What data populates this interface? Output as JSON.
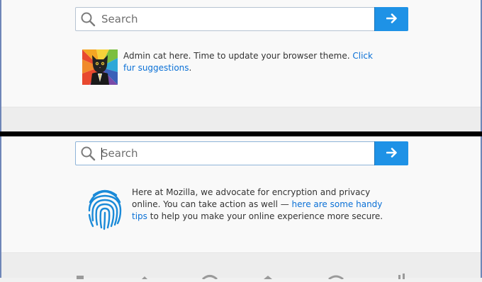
{
  "top_panel": {
    "search": {
      "placeholder": "Search"
    },
    "snippet": {
      "text": "Admin cat here. Time to update your browser theme. ",
      "link": "Click fur suggestions",
      "tail": "."
    }
  },
  "bottom_panel": {
    "search": {
      "placeholder": "Search"
    },
    "snippet": {
      "text_before": "Here at Mozilla, we advocate for encryption and privacy online. You can take action as well — ",
      "link": "here are some handy tips",
      "text_after": " to help you make your online experience more secure."
    }
  },
  "icons": {
    "search": "search-icon",
    "go": "arrow-right-icon",
    "cat": "admin-cat-image",
    "fingerprint": "fingerprint-icon"
  },
  "colors": {
    "accent": "#1e92e6",
    "link": "#0a70d6",
    "fingerprint": "#1a8ad8"
  }
}
